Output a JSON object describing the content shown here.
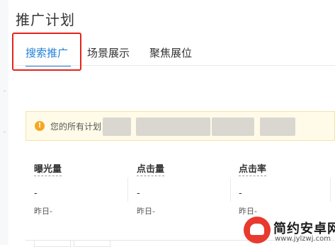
{
  "page": {
    "title": "推广计划"
  },
  "tabs": [
    {
      "label": "搜索推广",
      "active": true
    },
    {
      "label": "场景展示",
      "active": false
    },
    {
      "label": "聚焦展位",
      "active": false
    }
  ],
  "notice": {
    "icon": "alert-icon",
    "text": "您的所有计划"
  },
  "stats": [
    {
      "label": "曝光量",
      "value": "-",
      "sub": "昨日-"
    },
    {
      "label": "点击量",
      "value": "-",
      "sub": "昨日-"
    },
    {
      "label": "点击率",
      "value": "-",
      "sub": "昨日-"
    }
  ],
  "watermark": {
    "name": "简约安卓网",
    "url": "www.jylzwj.com"
  },
  "colors": {
    "accent": "#1f7fd6",
    "highlight": "#e5231a",
    "notice_bg": "#fffbe8",
    "warning": "#f5a623"
  }
}
